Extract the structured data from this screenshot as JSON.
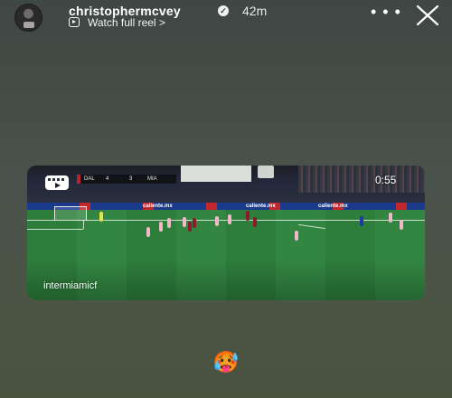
{
  "story_header": {
    "username": "christophermcvey",
    "verified_icon": "verified-badge-icon",
    "time_ago": "42m",
    "reel_link_label": "Watch full reel >",
    "more_label": "• • •",
    "close_icon": "close-icon"
  },
  "shared_reel": {
    "duration": "0:55",
    "account": "intermiamicf",
    "scoreboard": {
      "home_team": "DAL",
      "home_score": "4",
      "away_score": "3",
      "away_team": "MIA"
    },
    "ad_text": "caliente.mx"
  },
  "sticker": {
    "emoji": "🥵"
  },
  "colors": {
    "background": "#4a524c",
    "text": "#ffffff",
    "pitch": "#2f7e3e"
  }
}
